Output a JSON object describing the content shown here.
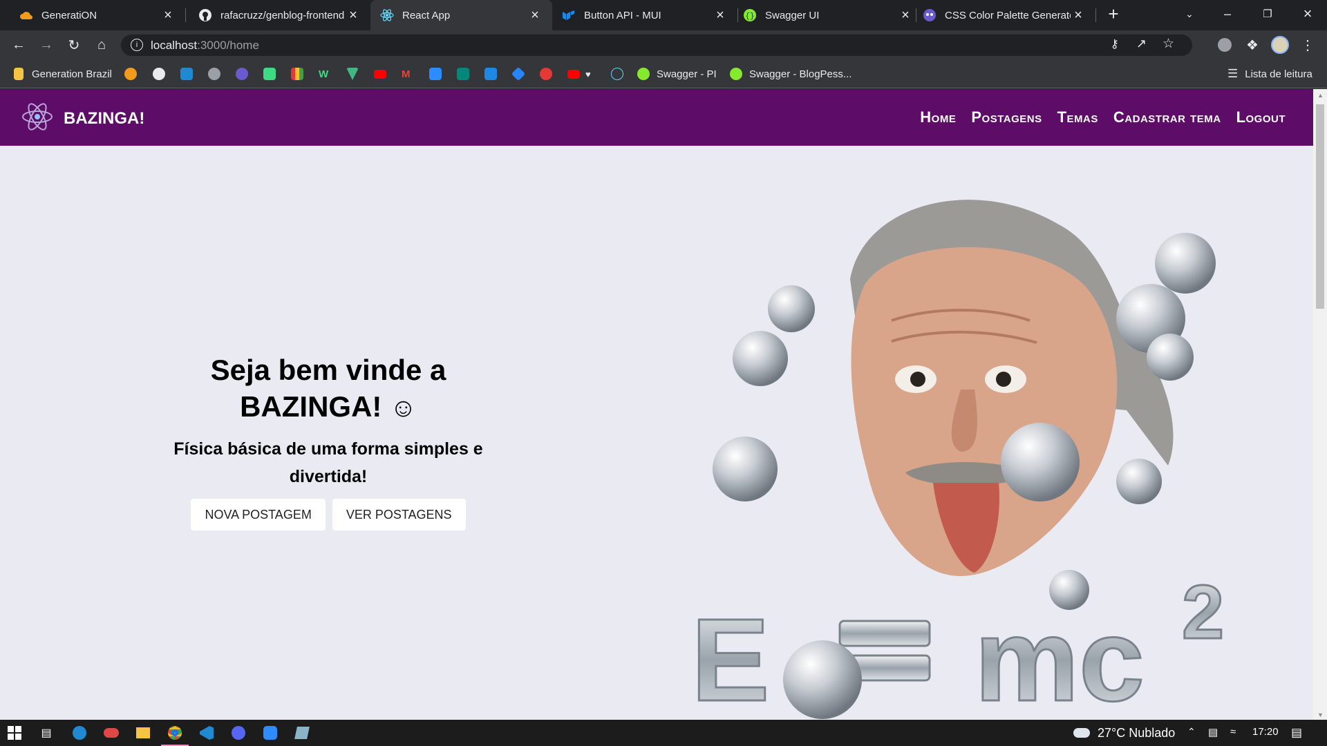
{
  "tabs": [
    {
      "title": "GeneratiON",
      "favicon": "cloud-icon"
    },
    {
      "title": "rafacruzz/genblog-frontend",
      "favicon": "github-icon"
    },
    {
      "title": "React App",
      "favicon": "react-icon",
      "active": true
    },
    {
      "title": "Button API - MUI",
      "favicon": "mui-icon"
    },
    {
      "title": "Swagger UI",
      "favicon": "swagger-icon"
    },
    {
      "title": "CSS Color Palette Generator",
      "favicon": "palette-icon"
    }
  ],
  "new_tab_label": "+",
  "address": {
    "host": "localhost",
    "path": ":3000/home"
  },
  "bookmarks": [
    {
      "label": "Generation Brazil",
      "color": "#f6c445"
    },
    {
      "label": "Swagger - PI",
      "color": "#85ea2d"
    },
    {
      "label": "Swagger - BlogPess...",
      "color": "#85ea2d"
    }
  ],
  "reading_list": "Lista de leitura",
  "navbar": {
    "brand": "BAZINGA!",
    "links": [
      "Home",
      "Postagens",
      "Temas",
      "Cadastrar tema",
      "Logout"
    ],
    "background": "#5d0c67"
  },
  "hero": {
    "title_line1": "Seja bem vinde a",
    "title_line2": "BAZINGA!",
    "emoji": "☺",
    "subtitle": "Física básica de uma forma simples e divertida!",
    "buttons": [
      "NOVA POSTAGEM",
      "VER POSTAGENS"
    ]
  },
  "taskbar": {
    "weather": "27°C  Nublado",
    "time": "17:20"
  }
}
